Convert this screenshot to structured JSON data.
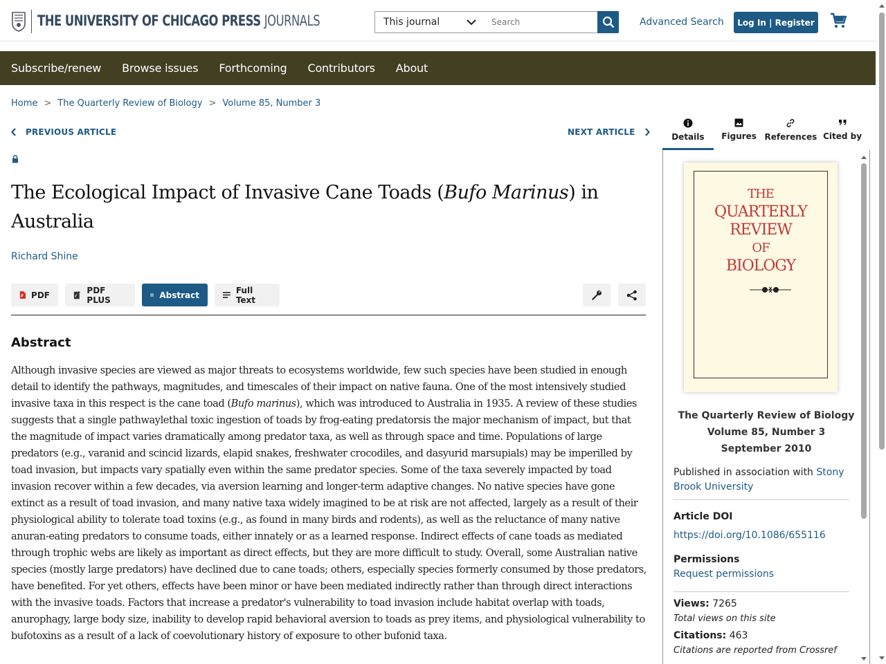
{
  "header": {
    "logo_main": "THE UNIVERSITY OF CHICAGO PRESS",
    "logo_sub": "JOURNALS",
    "scope_select": "This journal",
    "search_placeholder": "Search",
    "advanced_search": "Advanced Search",
    "login": "Log In | Register"
  },
  "nav": {
    "items": [
      "Subscribe/renew",
      "Browse issues",
      "Forthcoming",
      "Contributors",
      "About"
    ]
  },
  "breadcrumb": [
    "Home",
    "The Quarterly Review of Biology",
    "Volume 85, Number 3"
  ],
  "article_nav": {
    "prev": "PREVIOUS ARTICLE",
    "next": "NEXT ARTICLE"
  },
  "article": {
    "title_pre": "The Ecological Impact of Invasive Cane Toads (",
    "title_italic": "Bufo Marinus",
    "title_post": ") in Australia",
    "author": "Richard Shine"
  },
  "tools": {
    "pdf": "PDF",
    "pdf_plus": "PDF PLUS",
    "abstract": "Abstract",
    "full_text": "Full Text"
  },
  "abstract": {
    "heading": "Abstract",
    "part1": "Although invasive species are viewed as major threats to ecosystems worldwide, few such species have been studied in enough detail to identify the pathways, magnitudes, and timescales of their impact on native fauna. One of the most intensively studied invasive taxa in this respect is the cane toad (",
    "italic": "Bufo marinus",
    "part2": "), which was introduced to Australia in 1935. A review of these studies suggests that a single pathwaylethal toxic ingestion of toads by frog-eating predatorsis the major mechanism of impact, but that the magnitude of impact varies dramatically among predator taxa, as well as through space and time. Populations of large predators (e.g., varanid and scincid lizards, elapid snakes, freshwater crocodiles, and dasyurid marsupials) may be imperilled by toad invasion, but impacts vary spatially even within the same predator species. Some of the taxa severely impacted by toad invasion recover within a few decades, via aversion learning and longer-term adaptive changes. No native species have gone extinct as a result of toad invasion, and many native taxa widely imagined to be at risk are not affected, largely as a result of their physiological ability to tolerate toad toxins (e.g., as found in many birds and rodents), as well as the reluctance of many native anuran-eating predators to consume toads, either innately or as a learned response. Indirect effects of cane toads as mediated through trophic webs are likely as important as direct effects, but they are more difficult to study. Overall, some Australian native species (mostly large predators) have declined due to cane toads; others, especially species formerly consumed by those predators, have benefited. For yet others, effects have been minor or have been mediated indirectly rather than through direct interactions with the invasive toads. Factors that increase a predator's vulnerability to toad invasion include habitat overlap with toads, anurophagy, large body size, inability to develop rapid behavioral aversion to toads as prey items, and physiological vulnerability to bufotoxins as a result of a lack of coevolutionary history of exposure to other bufonid taxa."
  },
  "sidebar": {
    "tabs": [
      "Details",
      "Figures",
      "References",
      "Cited by"
    ],
    "cover": {
      "line1": "THE",
      "line2": "QUARTERLY",
      "line3": "REVIEW",
      "line4": "OF",
      "line5": "BIOLOGY"
    },
    "journal": "The Quarterly Review of Biology",
    "volume": "Volume 85, Number 3",
    "date": "September 2010",
    "assoc_prefix": "Published in association with ",
    "assoc_link": "Stony Brook University",
    "doi_heading": "Article DOI",
    "doi": "https://doi.org/10.1086/655116",
    "permissions_heading": "Permissions",
    "permissions_link": "Request permissions",
    "views_label": "Views:",
    "views_value": "7265",
    "views_note": "Total views on this site",
    "citations_label": "Citations:",
    "citations_value": "463",
    "citations_note": "Citations are reported from Crossref"
  },
  "colors": {
    "brand_blue": "#1d5a86",
    "nav_bg": "#423f23",
    "cover_red": "#c0393b"
  }
}
